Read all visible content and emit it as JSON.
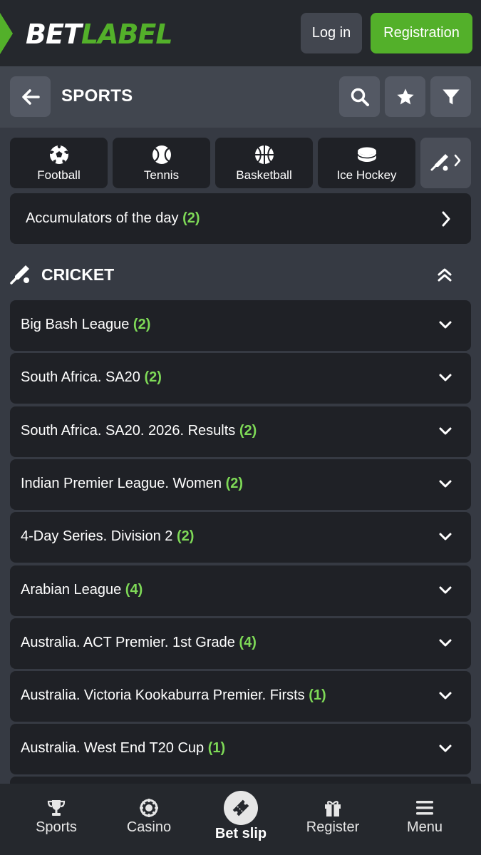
{
  "header": {
    "logo_bet": "BET",
    "logo_label": "LABEL",
    "login_label": "Log in",
    "registration_label": "Registration"
  },
  "sportsbar": {
    "title": "SPORTS"
  },
  "sport_tabs": [
    {
      "label": "Football",
      "icon": "football-icon"
    },
    {
      "label": "Tennis",
      "icon": "tennis-icon"
    },
    {
      "label": "Basketball",
      "icon": "basketball-icon"
    },
    {
      "label": "Ice Hockey",
      "icon": "ice-hockey-icon"
    }
  ],
  "accumulators": {
    "label": "Accumulators of the day",
    "count": "(2)"
  },
  "section": {
    "title": "CRICKET"
  },
  "leagues": [
    {
      "name": "Big Bash League",
      "count": "(2)"
    },
    {
      "name": "South Africa. SA20",
      "count": "(2)"
    },
    {
      "name": "South Africa. SA20. 2026. Results",
      "count": "(2)"
    },
    {
      "name": "Indian Premier League. Women",
      "count": "(2)"
    },
    {
      "name": "4-Day Series. Division 2",
      "count": "(2)"
    },
    {
      "name": "Arabian League",
      "count": "(4)"
    },
    {
      "name": "Australia. ACT Premier. 1st Grade",
      "count": "(4)"
    },
    {
      "name": "Australia. Victoria Kookaburra Premier. Firsts",
      "count": "(1)"
    },
    {
      "name": "Australia. West End T20 Cup",
      "count": "(1)"
    }
  ],
  "bottom_nav": [
    {
      "label": "Sports",
      "icon": "trophy-icon"
    },
    {
      "label": "Casino",
      "icon": "casino-chip-icon"
    },
    {
      "label": "Bet slip",
      "icon": "ticket-icon"
    },
    {
      "label": "Register",
      "icon": "gift-icon"
    },
    {
      "label": "Menu",
      "icon": "hamburger-icon"
    }
  ],
  "colors": {
    "brand_green": "#53b02a",
    "count_green": "#7ed957",
    "header_bg": "#25282d",
    "row_bg": "#1f2126"
  }
}
